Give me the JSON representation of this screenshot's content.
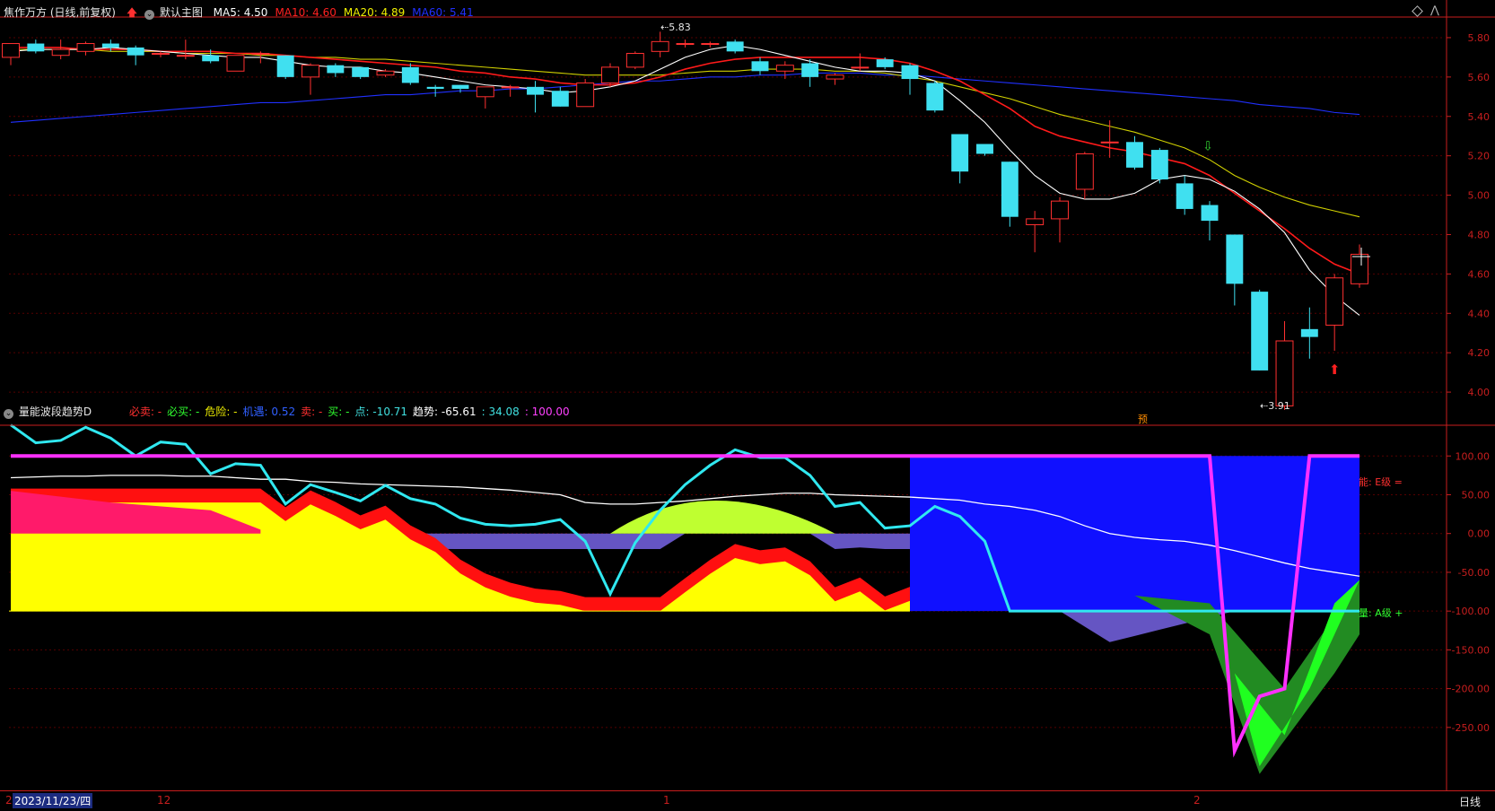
{
  "header": {
    "stock": "焦作万方 (日线,前复权)",
    "template": "默认主图",
    "ma": [
      {
        "label": "MA5:",
        "value": "4.50",
        "color": "#ffffff"
      },
      {
        "label": "MA10:",
        "value": "4.60",
        "color": "#ff2020"
      },
      {
        "label": "MA20:",
        "value": "4.89",
        "color": "#f0f000"
      },
      {
        "label": "MA60:",
        "value": "5.41",
        "color": "#2030ff"
      }
    ]
  },
  "sub_header": {
    "name": "量能波段趋势D",
    "items": [
      {
        "label": "必卖:",
        "value": "-",
        "color": "#ff3030"
      },
      {
        "label": "必买:",
        "value": "-",
        "color": "#30ff30"
      },
      {
        "label": "危险:",
        "value": "-",
        "color": "#f0f000"
      },
      {
        "label": "机遇:",
        "value": "0.52",
        "color": "#3060ff"
      },
      {
        "label": "卖:",
        "value": "-",
        "color": "#ff3030"
      },
      {
        "label": "买:",
        "value": "-",
        "color": "#30ff30"
      },
      {
        "label": "点:",
        "value": "-10.71",
        "color": "#40e0e0"
      },
      {
        "label": "趋势:",
        "value": "-65.61",
        "color": "#ffffff"
      },
      {
        "label": ":",
        "value": "34.08",
        "color": "#40e0e0"
      },
      {
        "label": ":",
        "value": "100.00",
        "color": "#ff40ff"
      }
    ]
  },
  "annotations": {
    "high": "5.83",
    "low": "3.91",
    "yu": "预",
    "right_top": "能: E级 =",
    "right_bottom": "量: A级 +"
  },
  "bottom_bar": {
    "date": "2023/11/23/四",
    "months": [
      "12",
      "1",
      "2"
    ],
    "period": "日线",
    "first_tick": "2"
  },
  "colors": {
    "up": "#ff3030",
    "down": "#40e0f0",
    "grid": "#550000",
    "axis": "#c81e1e"
  },
  "chart_data": [
    {
      "type": "candlestick",
      "title": "焦作万方 (日线,前复权)",
      "ylim": [
        3.85,
        5.9
      ],
      "y_ticks": [
        "5.80",
        "5.60",
        "5.40",
        "5.20",
        "5.00",
        "4.80",
        "4.60",
        "4.40",
        "4.20",
        "4.00"
      ],
      "candles": [
        {
          "o": 5.7,
          "h": 5.77,
          "l": 5.66,
          "c": 5.77
        },
        {
          "o": 5.77,
          "h": 5.79,
          "l": 5.72,
          "c": 5.73
        },
        {
          "o": 5.71,
          "h": 5.79,
          "l": 5.69,
          "c": 5.74
        },
        {
          "o": 5.73,
          "h": 5.78,
          "l": 5.71,
          "c": 5.77
        },
        {
          "o": 5.77,
          "h": 5.79,
          "l": 5.73,
          "c": 5.75
        },
        {
          "o": 5.75,
          "h": 5.76,
          "l": 5.66,
          "c": 5.71
        },
        {
          "o": 5.72,
          "h": 5.73,
          "l": 5.7,
          "c": 5.72
        },
        {
          "o": 5.71,
          "h": 5.79,
          "l": 5.69,
          "c": 5.71
        },
        {
          "o": 5.71,
          "h": 5.74,
          "l": 5.67,
          "c": 5.68
        },
        {
          "o": 5.63,
          "h": 5.71,
          "l": 5.63,
          "c": 5.71
        },
        {
          "o": 5.72,
          "h": 5.73,
          "l": 5.67,
          "c": 5.72
        },
        {
          "o": 5.71,
          "h": 5.71,
          "l": 5.59,
          "c": 5.6
        },
        {
          "o": 5.6,
          "h": 5.67,
          "l": 5.51,
          "c": 5.66
        },
        {
          "o": 5.66,
          "h": 5.67,
          "l": 5.6,
          "c": 5.62
        },
        {
          "o": 5.65,
          "h": 5.65,
          "l": 5.59,
          "c": 5.6
        },
        {
          "o": 5.61,
          "h": 5.64,
          "l": 5.6,
          "c": 5.63
        },
        {
          "o": 5.65,
          "h": 5.67,
          "l": 5.56,
          "c": 5.57
        },
        {
          "o": 5.55,
          "h": 5.56,
          "l": 5.5,
          "c": 5.54
        },
        {
          "o": 5.56,
          "h": 5.56,
          "l": 5.52,
          "c": 5.54
        },
        {
          "o": 5.5,
          "h": 5.55,
          "l": 5.44,
          "c": 5.55
        },
        {
          "o": 5.55,
          "h": 5.56,
          "l": 5.5,
          "c": 5.55
        },
        {
          "o": 5.55,
          "h": 5.58,
          "l": 5.42,
          "c": 5.51
        },
        {
          "o": 5.53,
          "h": 5.55,
          "l": 5.45,
          "c": 5.45
        },
        {
          "o": 5.45,
          "h": 5.59,
          "l": 5.45,
          "c": 5.57
        },
        {
          "o": 5.57,
          "h": 5.67,
          "l": 5.55,
          "c": 5.65
        },
        {
          "o": 5.65,
          "h": 5.73,
          "l": 5.64,
          "c": 5.72
        },
        {
          "o": 5.73,
          "h": 5.83,
          "l": 5.7,
          "c": 5.78
        },
        {
          "o": 5.77,
          "h": 5.79,
          "l": 5.75,
          "c": 5.77
        },
        {
          "o": 5.77,
          "h": 5.78,
          "l": 5.75,
          "c": 5.77
        },
        {
          "o": 5.78,
          "h": 5.79,
          "l": 5.72,
          "c": 5.73
        },
        {
          "o": 5.68,
          "h": 5.7,
          "l": 5.61,
          "c": 5.63
        },
        {
          "o": 5.63,
          "h": 5.68,
          "l": 5.59,
          "c": 5.66
        },
        {
          "o": 5.67,
          "h": 5.69,
          "l": 5.55,
          "c": 5.6
        },
        {
          "o": 5.59,
          "h": 5.62,
          "l": 5.56,
          "c": 5.61
        },
        {
          "o": 5.65,
          "h": 5.72,
          "l": 5.63,
          "c": 5.65
        },
        {
          "o": 5.69,
          "h": 5.7,
          "l": 5.64,
          "c": 5.65
        },
        {
          "o": 5.66,
          "h": 5.67,
          "l": 5.51,
          "c": 5.59
        },
        {
          "o": 5.57,
          "h": 5.58,
          "l": 5.42,
          "c": 5.43
        },
        {
          "o": 5.31,
          "h": 5.31,
          "l": 5.06,
          "c": 5.12
        },
        {
          "o": 5.26,
          "h": 5.26,
          "l": 5.2,
          "c": 5.21
        },
        {
          "o": 5.17,
          "h": 5.17,
          "l": 4.84,
          "c": 4.89
        },
        {
          "o": 4.85,
          "h": 4.92,
          "l": 4.71,
          "c": 4.88
        },
        {
          "o": 4.88,
          "h": 4.99,
          "l": 4.76,
          "c": 4.97
        },
        {
          "o": 5.03,
          "h": 5.22,
          "l": 4.98,
          "c": 5.21
        },
        {
          "o": 5.27,
          "h": 5.38,
          "l": 5.19,
          "c": 5.27
        },
        {
          "o": 5.27,
          "h": 5.3,
          "l": 5.13,
          "c": 5.14
        },
        {
          "o": 5.23,
          "h": 5.24,
          "l": 5.06,
          "c": 5.08
        },
        {
          "o": 5.06,
          "h": 5.1,
          "l": 4.9,
          "c": 4.93
        },
        {
          "o": 4.95,
          "h": 4.97,
          "l": 4.77,
          "c": 4.87
        },
        {
          "o": 4.8,
          "h": 4.8,
          "l": 4.44,
          "c": 4.55
        },
        {
          "o": 4.51,
          "h": 4.52,
          "l": 4.11,
          "c": 4.11
        },
        {
          "o": 3.93,
          "h": 4.36,
          "l": 3.91,
          "c": 4.26
        },
        {
          "o": 4.32,
          "h": 4.43,
          "l": 4.17,
          "c": 4.28
        },
        {
          "o": 4.34,
          "h": 4.6,
          "l": 4.21,
          "c": 4.58
        },
        {
          "o": 4.55,
          "h": 4.75,
          "l": 4.53,
          "c": 4.7
        }
      ],
      "ma5": [
        5.73,
        5.74,
        5.74,
        5.74,
        5.75,
        5.74,
        5.73,
        5.72,
        5.71,
        5.7,
        5.7,
        5.68,
        5.66,
        5.65,
        5.65,
        5.63,
        5.62,
        5.6,
        5.58,
        5.56,
        5.55,
        5.54,
        5.52,
        5.53,
        5.55,
        5.58,
        5.64,
        5.7,
        5.74,
        5.76,
        5.74,
        5.71,
        5.68,
        5.65,
        5.63,
        5.63,
        5.62,
        5.58,
        5.48,
        5.37,
        5.23,
        5.1,
        5.01,
        4.98,
        4.98,
        5.01,
        5.08,
        5.1,
        5.08,
        5.02,
        4.93,
        4.81,
        4.62,
        4.49,
        4.39,
        4.4,
        4.48
      ],
      "ma10": [
        5.75,
        5.75,
        5.75,
        5.74,
        5.74,
        5.74,
        5.73,
        5.73,
        5.73,
        5.72,
        5.72,
        5.71,
        5.7,
        5.69,
        5.68,
        5.67,
        5.66,
        5.65,
        5.63,
        5.62,
        5.6,
        5.59,
        5.57,
        5.56,
        5.56,
        5.57,
        5.6,
        5.64,
        5.67,
        5.69,
        5.7,
        5.7,
        5.7,
        5.7,
        5.7,
        5.69,
        5.67,
        5.63,
        5.58,
        5.51,
        5.44,
        5.35,
        5.3,
        5.27,
        5.24,
        5.22,
        5.19,
        5.16,
        5.1,
        5.01,
        4.92,
        4.83,
        4.73,
        4.65,
        4.6
      ],
      "ma20": [
        5.74,
        5.74,
        5.74,
        5.74,
        5.73,
        5.73,
        5.73,
        5.72,
        5.72,
        5.72,
        5.71,
        5.71,
        5.7,
        5.7,
        5.69,
        5.69,
        5.68,
        5.67,
        5.66,
        5.65,
        5.64,
        5.63,
        5.62,
        5.61,
        5.61,
        5.61,
        5.61,
        5.62,
        5.63,
        5.63,
        5.64,
        5.64,
        5.64,
        5.63,
        5.63,
        5.62,
        5.6,
        5.58,
        5.55,
        5.52,
        5.49,
        5.45,
        5.41,
        5.38,
        5.35,
        5.32,
        5.28,
        5.24,
        5.18,
        5.1,
        5.04,
        4.99,
        4.95,
        4.92,
        4.89
      ],
      "ma60": [
        5.37,
        5.38,
        5.39,
        5.4,
        5.41,
        5.42,
        5.43,
        5.44,
        5.45,
        5.46,
        5.47,
        5.47,
        5.48,
        5.49,
        5.5,
        5.51,
        5.51,
        5.52,
        5.53,
        5.53,
        5.54,
        5.54,
        5.55,
        5.56,
        5.57,
        5.58,
        5.58,
        5.59,
        5.6,
        5.6,
        5.61,
        5.61,
        5.62,
        5.62,
        5.62,
        5.61,
        5.61,
        5.6,
        5.59,
        5.58,
        5.57,
        5.56,
        5.55,
        5.54,
        5.53,
        5.52,
        5.51,
        5.5,
        5.49,
        5.48,
        5.46,
        5.45,
        5.44,
        5.42,
        5.41
      ]
    },
    {
      "type": "area",
      "title": "量能波段趋势D",
      "ylim": [
        -330,
        135
      ],
      "y_ticks": [
        "100.00",
        "50.00",
        "0.00",
        "-50.00",
        "-100.00",
        "-150.00",
        "-200.00",
        "-250.00"
      ],
      "series": [
        {
          "name": "点",
          "values": [
            140,
            117,
            120,
            137,
            123,
            100,
            118,
            115,
            77,
            90,
            88,
            38,
            63,
            53,
            42,
            62,
            45,
            38,
            20,
            12,
            10,
            12,
            18,
            -10,
            -78,
            -12,
            30,
            63,
            88,
            108,
            98,
            98,
            75,
            35,
            40,
            7,
            10,
            35,
            22,
            -10,
            -100,
            -100,
            -100,
            -100,
            -100,
            -100,
            -100,
            -100,
            -100,
            -100,
            -100,
            -100,
            -100,
            -100,
            -100,
            -100,
            -100
          ]
        },
        {
          "name": "趋势",
          "values": [
            72,
            73,
            74,
            74,
            75,
            75,
            75,
            74,
            74,
            72,
            70,
            70,
            67,
            66,
            64,
            63,
            62,
            61,
            60,
            58,
            56,
            53,
            50,
            40,
            38,
            38,
            40,
            42,
            45,
            48,
            50,
            52,
            52,
            50,
            49,
            48,
            47,
            45,
            43,
            38,
            35,
            30,
            22,
            10,
            0,
            -5,
            -8,
            -10,
            -15,
            -22,
            -30,
            -38,
            -45,
            -50,
            -55,
            -58,
            -60
          ]
        },
        {
          "name": "100",
          "values": [
            100,
            100,
            100,
            100,
            100,
            100,
            100,
            100,
            100,
            100,
            100,
            100,
            100,
            100,
            100,
            100,
            100,
            100,
            100,
            100,
            100,
            100,
            100,
            100,
            100,
            100,
            100,
            100,
            100,
            100,
            100,
            100,
            100,
            100,
            100,
            100,
            100,
            100,
            100,
            100,
            100,
            100,
            100,
            100,
            100,
            100,
            100,
            100,
            100,
            -280,
            -210,
            -200,
            100,
            100,
            100,
            100
          ]
        }
      ]
    }
  ]
}
